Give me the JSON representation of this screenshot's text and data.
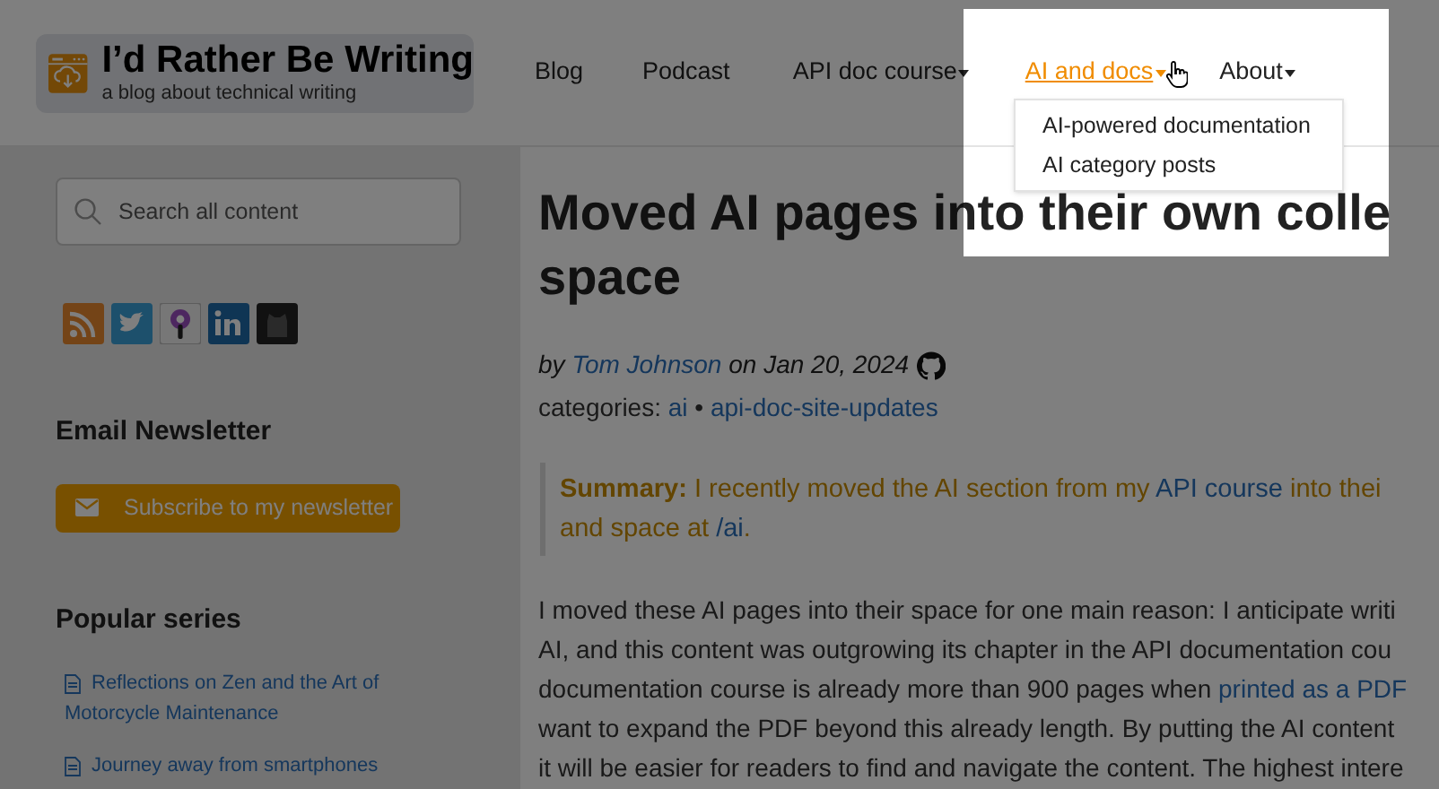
{
  "site": {
    "title": "I’d Rather Be Writing",
    "tagline": "a blog about technical writing"
  },
  "nav": [
    {
      "label": "Blog",
      "dropdown": false,
      "selected": false
    },
    {
      "label": "Podcast",
      "dropdown": false,
      "selected": false
    },
    {
      "label": "API doc course",
      "dropdown": true,
      "selected": false
    },
    {
      "label": "AI and docs",
      "dropdown": true,
      "selected": true
    },
    {
      "label": "About",
      "dropdown": true,
      "selected": false
    }
  ],
  "dropdown_menu": [
    "AI-powered documentation",
    "AI category posts"
  ],
  "sidebar": {
    "search": {
      "placeholder": "Search all content"
    },
    "newsletter_heading": "Email Newsletter",
    "subscribe_button": "Subscribe to my newsletter",
    "popular_heading": "Popular series",
    "popular": [
      {
        "lines": [
          "Reflections on Zen and the Art of",
          "Motorcycle Maintenance"
        ]
      },
      {
        "lines": [
          "Journey away from smartphones"
        ]
      }
    ]
  },
  "article": {
    "title_lines": [
      "Moved AI pages into their own colle",
      "space"
    ],
    "byline": [
      {
        "kind": "text",
        "text": "by "
      },
      {
        "kind": "link",
        "text": "Tom Johnson"
      },
      {
        "kind": "text",
        "text": " on Jan 20, 2024"
      }
    ],
    "categories": [
      {
        "kind": "text",
        "text": "categories: "
      },
      {
        "kind": "link",
        "text": "ai"
      },
      {
        "kind": "text",
        "text": " • "
      },
      {
        "kind": "link",
        "text": "api-doc-site-updates"
      }
    ],
    "summary_lines": [
      [
        {
          "kind": "bold",
          "text": "Summary:"
        },
        {
          "kind": "text",
          "text": " I recently moved the AI section from my "
        },
        {
          "kind": "link",
          "text": "API course"
        },
        {
          "kind": "text",
          "text": " into thei"
        }
      ],
      [
        {
          "kind": "text",
          "text": "and space at "
        },
        {
          "kind": "link",
          "text": "/ai"
        },
        {
          "kind": "text",
          "text": "."
        }
      ]
    ],
    "body_lines": [
      [
        {
          "kind": "text",
          "text": "I moved these AI pages into their space for one main reason: I anticipate writi"
        }
      ],
      [
        {
          "kind": "text",
          "text": "AI, and this content was outgrowing its chapter in the API documentation cou"
        }
      ],
      [
        {
          "kind": "text",
          "text": "documentation course is already more than 900 pages when "
        },
        {
          "kind": "link",
          "text": "printed as a PDF"
        }
      ],
      [
        {
          "kind": "text",
          "text": "want to expand the PDF beyond this already length. By putting the AI content"
        }
      ],
      [
        {
          "kind": "text",
          "text": "it will be easier for readers to find and navigate the content. The highest intere"
        }
      ]
    ]
  }
}
